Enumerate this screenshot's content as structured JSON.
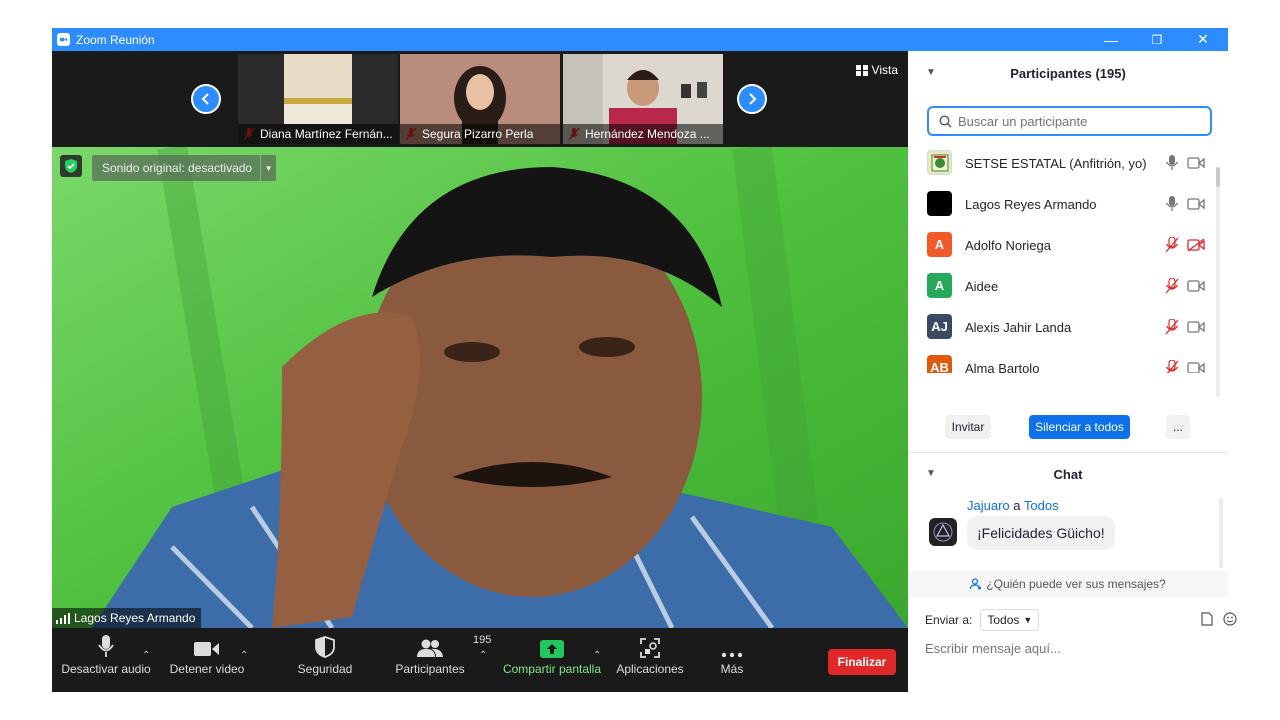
{
  "window": {
    "title": "Zoom Reunión",
    "minimize_glyph": "—",
    "restore_glyph": "❐",
    "close_glyph": "✕"
  },
  "strip": {
    "thumbnails": [
      {
        "name": "Diana Martínez Fernán..."
      },
      {
        "name": "Segura Pizarro Perla"
      },
      {
        "name": "Hernández Mendoza ..."
      }
    ],
    "view_label": "Vista"
  },
  "main_video": {
    "speaker": "Lagos Reyes Armando",
    "original_sound": "Sonido original: desactivado"
  },
  "toolbar": {
    "audio": "Desactivar audio",
    "video": "Detener video",
    "security": "Seguridad",
    "participants": "Participantes",
    "participants_count": "195",
    "share": "Compartir pantalla",
    "apps": "Aplicaciones",
    "more": "Más",
    "end": "Finalizar"
  },
  "participants_panel": {
    "title": "Participantes (195)",
    "search_placeholder": "Buscar un participante",
    "list": [
      {
        "name": "SETSE ESTATAL (Anfitrión, yo)",
        "initials": "",
        "color": "#e8e8c0",
        "mic": "on",
        "cam": "on"
      },
      {
        "name": "Lagos Reyes Armando",
        "initials": "",
        "color": "#000000",
        "mic": "on",
        "cam": "on"
      },
      {
        "name": "Adolfo Noriega",
        "initials": "A",
        "color": "#f05a28",
        "mic": "muted",
        "cam": "off"
      },
      {
        "name": "Aidee",
        "initials": "A",
        "color": "#26a95a",
        "mic": "muted",
        "cam": "on"
      },
      {
        "name": "Alexis Jahir Landa",
        "initials": "AJ",
        "color": "#3b4a63",
        "mic": "muted",
        "cam": "on"
      },
      {
        "name": "Alma Bartolo",
        "initials": "AB",
        "color": "#e05a0a",
        "mic": "muted",
        "cam": "on"
      }
    ],
    "invite": "Invitar",
    "mute_all": "Silenciar a todos",
    "more": "..."
  },
  "chat_panel": {
    "title": "Chat",
    "message": {
      "from": "Jajuaro",
      "connector": "a",
      "to": "Todos",
      "text": "¡Felicidades Güicho!"
    },
    "who_sees": "¿Quién puede ver sus mensajes?",
    "send_to_label": "Enviar a:",
    "send_to_value": "Todos",
    "input_placeholder": "Escribir mensaje aquí..."
  },
  "colors": {
    "title_bar": "#2d8cff",
    "end_button": "#e02828",
    "share_icon": "#22c55e",
    "mute_red": "#e02828"
  }
}
